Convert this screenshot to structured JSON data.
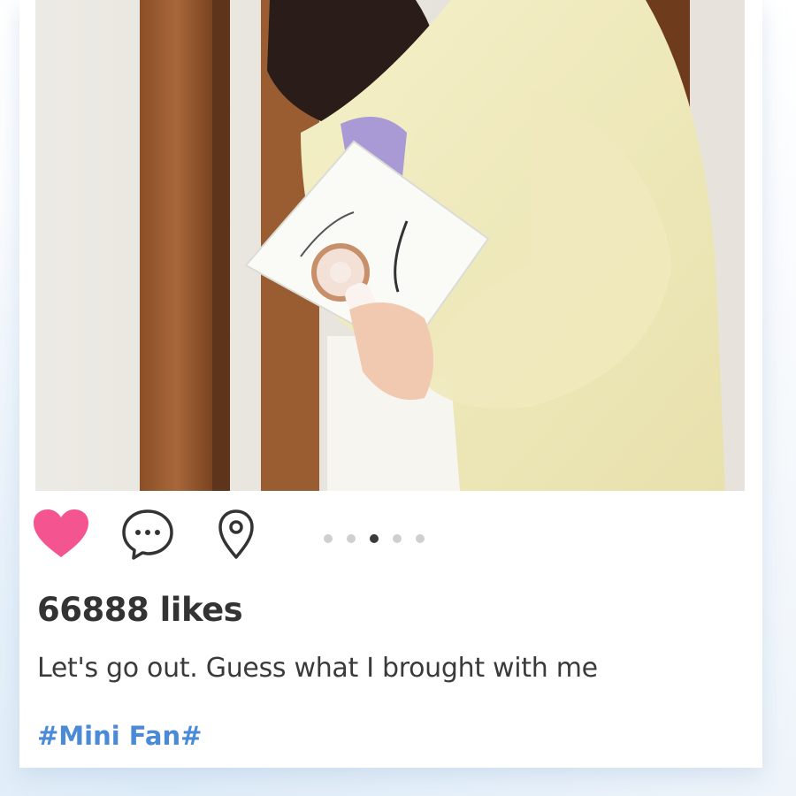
{
  "post": {
    "photo": {
      "alt_description": "",
      "icon": "photo-image"
    },
    "actions": {
      "like_icon": "heart-icon",
      "comment_icon": "comment-bubble-icon",
      "location_icon": "location-pin-icon",
      "like_color": "#f4548f"
    },
    "carousel": {
      "total": 5,
      "active_index": 2
    },
    "likes_text": "66888 likes",
    "caption": "Let's go out. Guess what I brought with me",
    "hashtag": "#Mini Fan#",
    "hashtag_color": "#4a8ad6"
  }
}
